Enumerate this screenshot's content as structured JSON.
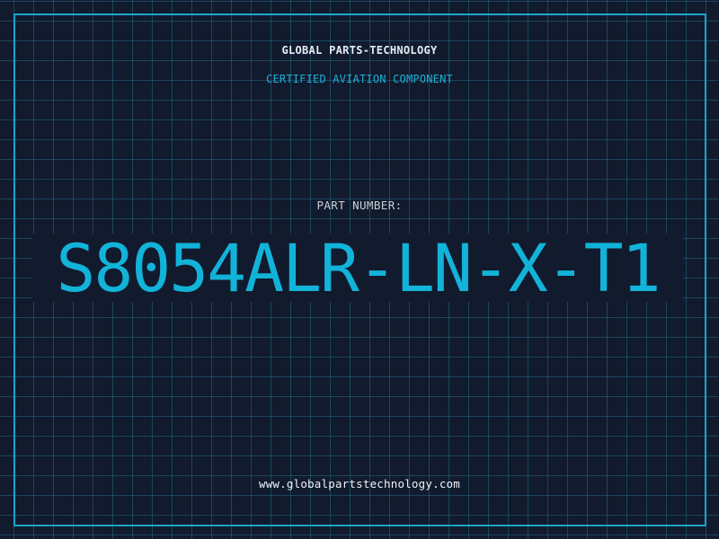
{
  "header": {
    "company_name": "GLOBAL PARTS-TECHNOLOGY",
    "certification": "CERTIFIED AVIATION COMPONENT"
  },
  "part": {
    "label": "PART NUMBER:",
    "number": "S8054ALR-LN-X-T1"
  },
  "footer": {
    "website": "www.globalpartstechnology.com"
  },
  "colors": {
    "background": "#121a2d",
    "grid": "#288caa",
    "frame": "#1aa6c9",
    "accent": "#12b3d9",
    "text": "#e6edf5"
  }
}
